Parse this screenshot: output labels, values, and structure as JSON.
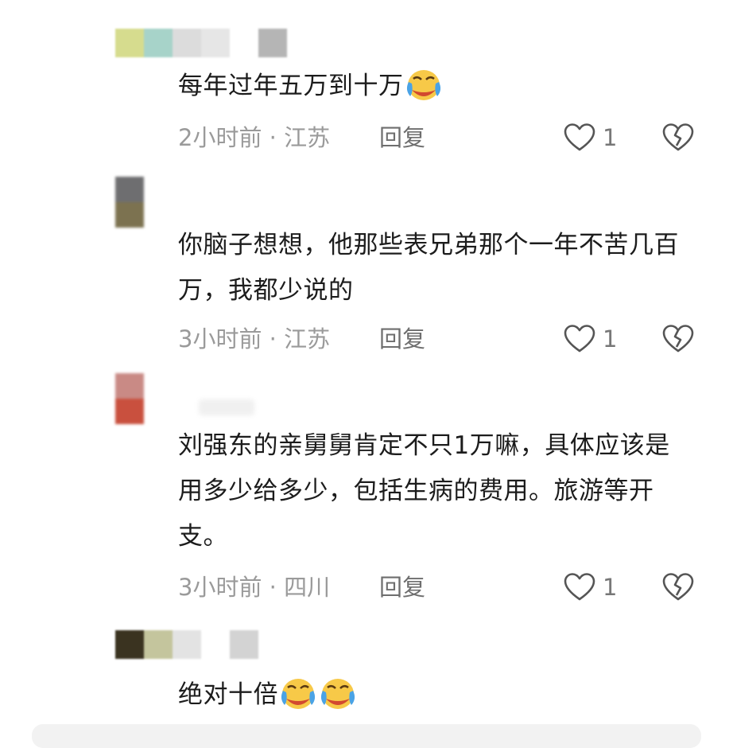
{
  "comments": [
    {
      "text_parts": [
        "每年过年五万到十万"
      ],
      "emoji_count": 1,
      "time": "2小时前",
      "location": "江苏",
      "reply_label": "回复",
      "likes": "1",
      "avatar_colors": [
        "#d6dc8e",
        "#a7d3c9"
      ],
      "mosaic_colors": [
        "#dcdcdc",
        "#e6e6e6",
        "#ffffff",
        "#b5b5b5"
      ]
    },
    {
      "text_parts": [
        "你脑子想想，他那些表兄弟那个一年不苦几百万，我都少说的"
      ],
      "time": "3小时前",
      "location": "江苏",
      "reply_label": "回复",
      "likes": "1",
      "avatar_colors": [
        "#6e6e70",
        "#7c7250"
      ]
    },
    {
      "text_parts": [
        "刘强东的亲舅舅肯定不只1万嘛，具体应该是用多少给多少，包括生病的费用。旅游等开支。"
      ],
      "time": "3小时前",
      "location": "四川",
      "reply_label": "回复",
      "likes": "1",
      "avatar_colors": [
        "#c98a85",
        "#c9503e"
      ]
    },
    {
      "text_parts": [
        "绝对十倍"
      ],
      "emoji_count": 2,
      "avatar_colors": [
        "#3a3320",
        "#c4c59d"
      ],
      "mosaic_colors": [
        "#e3e3e3",
        "#ffffff",
        "#d3d3d3"
      ]
    }
  ],
  "separator": "·",
  "colors": {
    "text": "#1c1c1c",
    "meta": "#9a9a9a",
    "reply": "#6e6e6e",
    "icon": "#555555"
  },
  "icons": {
    "like": "heart-outline-icon",
    "dislike": "broken-heart-icon",
    "emoji": "crying-laughing-emoji"
  }
}
